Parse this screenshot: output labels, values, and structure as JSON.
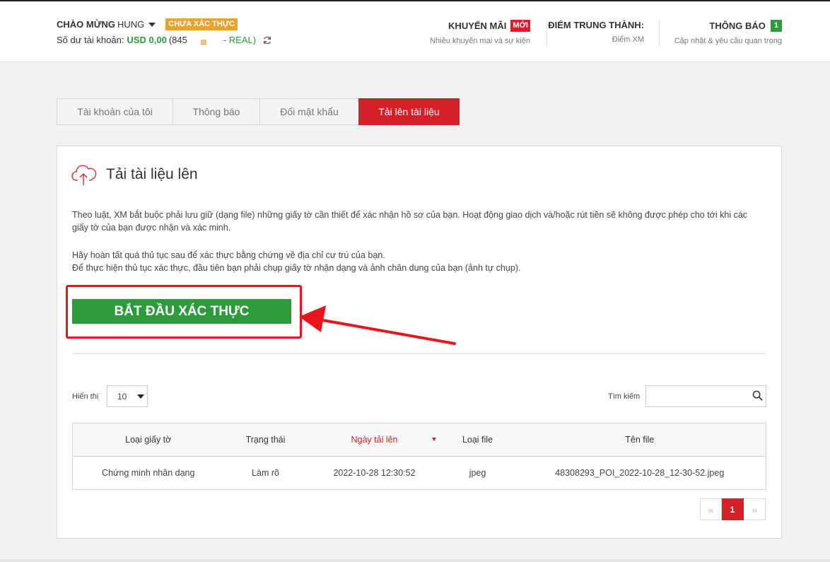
{
  "header": {
    "welcome_prefix": "CHÀO MỪNG",
    "username": "HUNG",
    "verify_status": "CHƯA XÁC THỰC",
    "balance_label": "Số dư tài khoản:",
    "balance_value": "USD 0,00",
    "account_open": "(845",
    "account_type": "- REAL)",
    "promo_title": "KHUYẾN MÃI",
    "promo_badge": "MỚI",
    "promo_sub": "Nhiều khuyến mại và sự kiện",
    "loyalty_title": "ĐIỂM TRUNG THÀNH:",
    "loyalty_sub": "Điểm XM",
    "notif_title": "THÔNG BÁO",
    "notif_count": "1",
    "notif_sub": "Cập nhật & yêu cầu quan trọng"
  },
  "tabs": [
    {
      "label": "Tài khoản của tôi",
      "active": false
    },
    {
      "label": "Thông báo",
      "active": false
    },
    {
      "label": "Đổi mật khẩu",
      "active": false
    },
    {
      "label": "Tải lên tài liệu",
      "active": true
    }
  ],
  "panel": {
    "title": "Tải tài liệu lên",
    "paragraph1": "Theo luật, XM bắt buộc phải lưu giữ (dạng file) những giấy tờ cần thiết để xác nhận hồ sơ của bạn. Hoạt động giao dịch và/hoặc rút tiền sẽ không được phép cho tới khi các giấy tờ của bạn được nhận và xác minh.",
    "paragraph2_line1": "Hãy hoàn tất quá thủ tục sau để xác thực bằng chứng về địa chỉ cư trú của bạn.",
    "paragraph2_line2": "Để thực hiện thủ tục xác thực, đầu tiên bạn phải chụp giấy tờ nhận dạng và ảnh chân dung của bạn (ảnh tự chụp).",
    "start_button": "BẮT ĐẦU XÁC THỰC"
  },
  "table_controls": {
    "show_label": "Hiển thị",
    "show_value": "10",
    "search_label": "Tìm kiếm",
    "search_value": ""
  },
  "table": {
    "columns": [
      "Loại giấy tờ",
      "Trạng thái",
      "Ngày tải lên",
      "Loại file",
      "Tên file"
    ],
    "rows": [
      [
        "Chứng minh nhân dạng",
        "Làm rõ",
        "2022-10-28 12:30:52",
        "jpeg",
        "48308293_POI_2022-10-28_12-30-52.jpeg"
      ]
    ]
  },
  "pagination": {
    "prev": "«",
    "current": "1",
    "next": "»"
  },
  "colors": {
    "accent_red": "#d61f26",
    "green": "#2d9b3c",
    "warning": "#e8a525"
  }
}
